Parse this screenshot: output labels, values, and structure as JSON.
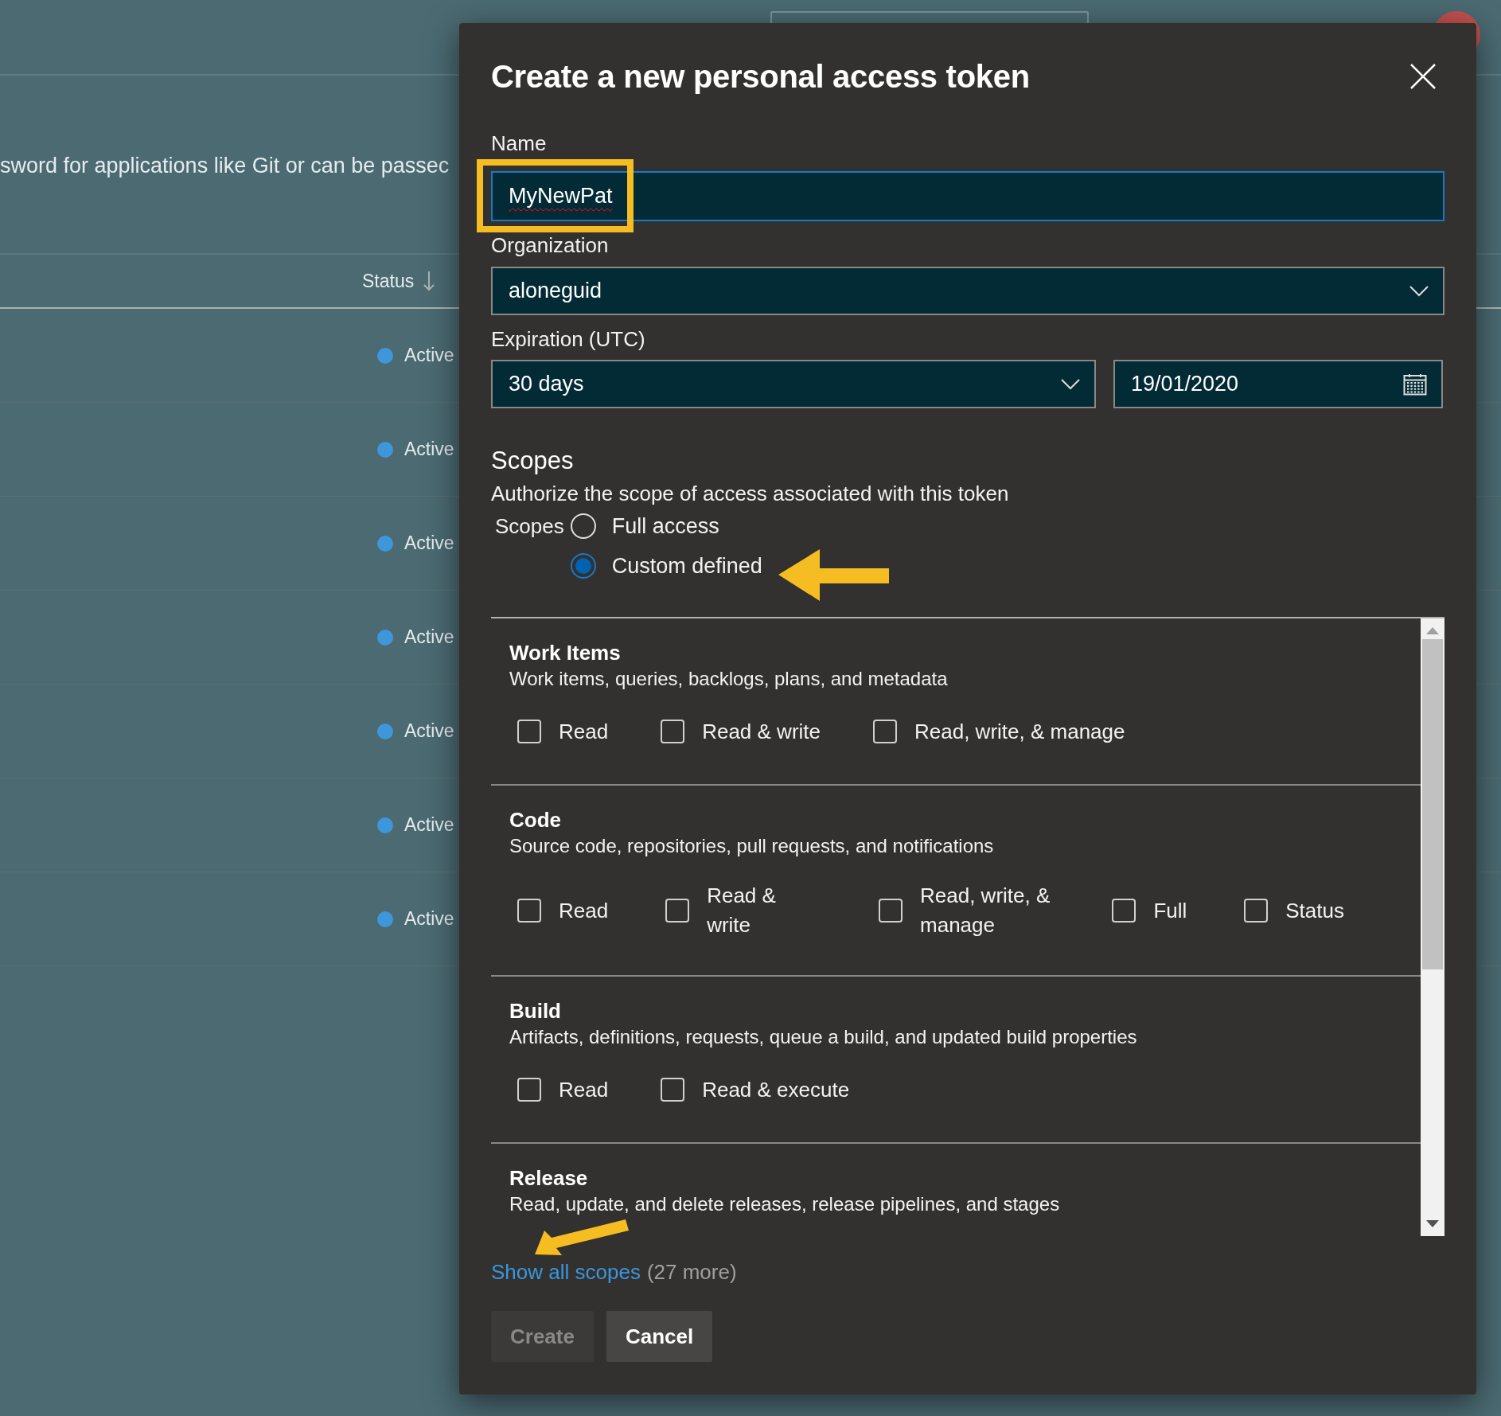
{
  "background": {
    "description": "sword for applications like Git or can be passec",
    "status_header": "Status",
    "rows": [
      {
        "status": "Active"
      },
      {
        "status": "Active"
      },
      {
        "status": "Active"
      },
      {
        "status": "Active"
      },
      {
        "status": "Active"
      },
      {
        "status": "Active"
      },
      {
        "status": "Active"
      }
    ]
  },
  "dialog": {
    "title": "Create a new personal access token",
    "name": {
      "label": "Name",
      "value": "MyNewPat"
    },
    "organization": {
      "label": "Organization",
      "value": "aloneguid"
    },
    "expiration": {
      "label": "Expiration (UTC)",
      "value": "30 days",
      "date": "19/01/2020"
    },
    "scopes": {
      "heading": "Scopes",
      "description": "Authorize the scope of access associated with this token",
      "label": "Scopes",
      "options": [
        {
          "label": "Full access",
          "selected": false
        },
        {
          "label": "Custom defined",
          "selected": true
        }
      ]
    },
    "sections": [
      {
        "title": "Work Items",
        "description": "Work items, queries, backlogs, plans, and metadata",
        "options": [
          {
            "label": "Read",
            "checked": false
          },
          {
            "label": "Read & write",
            "checked": false
          },
          {
            "label": "Read, write, & manage",
            "checked": false
          }
        ]
      },
      {
        "title": "Code",
        "description": "Source code, repositories, pull requests, and notifications",
        "options": [
          {
            "label": "Read",
            "checked": false
          },
          {
            "label": "Read & write",
            "checked": false
          },
          {
            "label": "Read, write, & manage",
            "checked": false
          },
          {
            "label": "Full",
            "checked": false
          },
          {
            "label": "Status",
            "checked": false
          }
        ]
      },
      {
        "title": "Build",
        "description": "Artifacts, definitions, requests, queue a build, and updated build properties",
        "options": [
          {
            "label": "Read",
            "checked": false
          },
          {
            "label": "Read & execute",
            "checked": false
          }
        ]
      },
      {
        "title": "Release",
        "description": "Read, update, and delete releases, release pipelines, and stages"
      }
    ],
    "show_all": {
      "link": "Show all scopes",
      "count": "(27 more)"
    },
    "buttons": [
      {
        "label": "Create",
        "disabled": true
      },
      {
        "label": "Cancel",
        "disabled": false
      }
    ]
  }
}
